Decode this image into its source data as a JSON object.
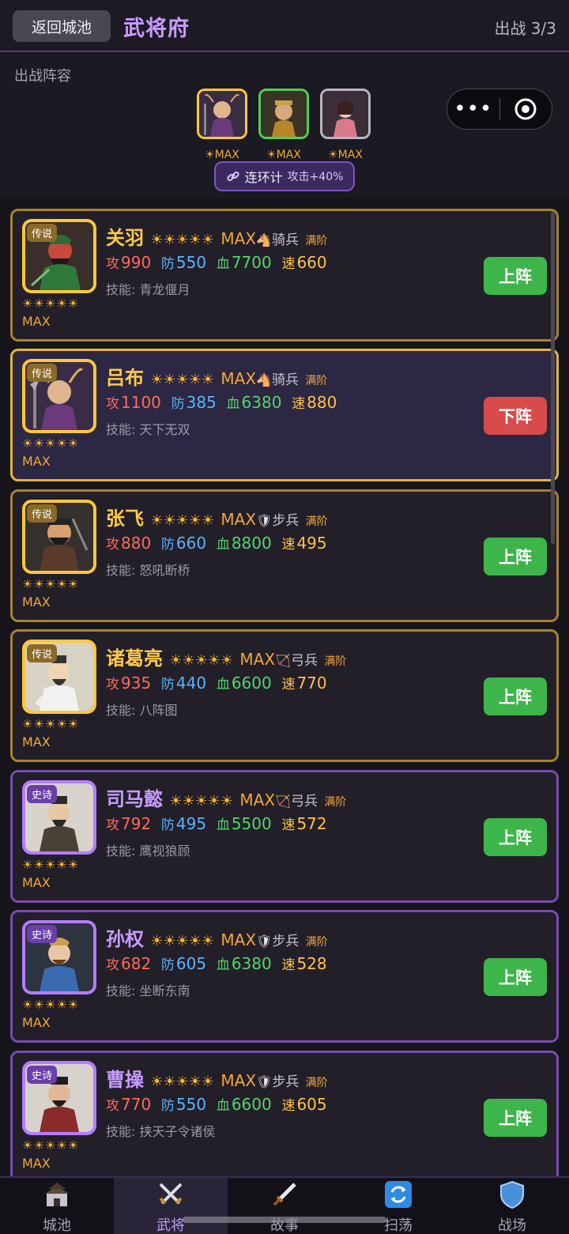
{
  "header": {
    "back_label": "返回城池",
    "title": "武将府",
    "deploy_count": "出战 3/3"
  },
  "lineup": {
    "label": "出战阵容",
    "slots": [
      {
        "caption": "☀MAX",
        "border": "#ffc73a"
      },
      {
        "caption": "☀MAX",
        "border": "#4ccf58"
      },
      {
        "caption": "☀MAX",
        "border": "#b8b5c0"
      }
    ],
    "combo_name": "连环计",
    "combo_effect": "攻击+40%"
  },
  "capsule": {
    "more_icon": "•••",
    "target_icon": "target-icon"
  },
  "labels": {
    "atk": "攻",
    "def": "防",
    "hp": "血",
    "spd": "速"
  },
  "generals": [
    {
      "name": "关羽",
      "rarity": "传说",
      "stars": "☀☀☀☀☀",
      "level": "MAX",
      "troop_icon": "🐴",
      "troop": "骑兵",
      "stage": "满阶",
      "atk": "990",
      "def": "550",
      "hp": "7700",
      "spd": "660",
      "skill": "技能: 青龙偃月",
      "action": "上阵",
      "active": false
    },
    {
      "name": "吕布",
      "rarity": "传说",
      "stars": "☀☀☀☀☀",
      "level": "MAX",
      "troop_icon": "🐴",
      "troop": "骑兵",
      "stage": "满阶",
      "atk": "1100",
      "def": "385",
      "hp": "6380",
      "spd": "880",
      "skill": "技能: 天下无双",
      "action": "下阵",
      "active": true
    },
    {
      "name": "张飞",
      "rarity": "传说",
      "stars": "☀☀☀☀☀",
      "level": "MAX",
      "troop_icon": "🛡",
      "troop": "步兵",
      "stage": "满阶",
      "atk": "880",
      "def": "660",
      "hp": "8800",
      "spd": "495",
      "skill": "技能: 怒吼断桥",
      "action": "上阵",
      "active": false
    },
    {
      "name": "诸葛亮",
      "rarity": "传说",
      "stars": "☀☀☀☀☀",
      "level": "MAX",
      "troop_icon": "🏹",
      "troop": "弓兵",
      "stage": "满阶",
      "atk": "935",
      "def": "440",
      "hp": "6600",
      "spd": "770",
      "skill": "技能: 八阵图",
      "action": "上阵",
      "active": false
    },
    {
      "name": "司马懿",
      "rarity": "史诗",
      "stars": "☀☀☀☀☀",
      "level": "MAX",
      "troop_icon": "🏹",
      "troop": "弓兵",
      "stage": "满阶",
      "atk": "792",
      "def": "495",
      "hp": "5500",
      "spd": "572",
      "skill": "技能: 鹰视狼顾",
      "action": "上阵",
      "active": false
    },
    {
      "name": "孙权",
      "rarity": "史诗",
      "stars": "☀☀☀☀☀",
      "level": "MAX",
      "troop_icon": "🛡",
      "troop": "步兵",
      "stage": "满阶",
      "atk": "682",
      "def": "605",
      "hp": "6380",
      "spd": "528",
      "skill": "技能: 坐断东南",
      "action": "上阵",
      "active": false
    },
    {
      "name": "曹操",
      "rarity": "史诗",
      "stars": "☀☀☀☀☀",
      "level": "MAX",
      "troop_icon": "🛡",
      "troop": "步兵",
      "stage": "满阶",
      "atk": "770",
      "def": "550",
      "hp": "6600",
      "spd": "605",
      "skill": "技能: 挟天子令诸侯",
      "action": "上阵",
      "active": false
    }
  ],
  "colors": {
    "legend_border": "#a8822e",
    "legend_portrait": "#ffc73a",
    "legend_name": "#ffc94a",
    "legend_badge": "#8a6a2a",
    "epic_border": "#7a4ab0",
    "epic_portrait": "#b57cff",
    "epic_name": "#c89bff",
    "epic_badge": "#6a3fa8",
    "active_border": "#e5b23a",
    "atk": "#ff6a5a",
    "def": "#5ab4ff",
    "hp": "#52d66a",
    "spd": "#ffc24a",
    "stage": "#f2a73a"
  },
  "nav": [
    {
      "label": "城池",
      "icon": "castle-icon",
      "active": false
    },
    {
      "label": "武将",
      "icon": "crossed-swords-icon",
      "active": true
    },
    {
      "label": "故事",
      "icon": "dagger-icon",
      "active": false
    },
    {
      "label": "扫荡",
      "icon": "refresh-icon",
      "active": false
    },
    {
      "label": "战场",
      "icon": "shield-icon",
      "active": false
    }
  ]
}
